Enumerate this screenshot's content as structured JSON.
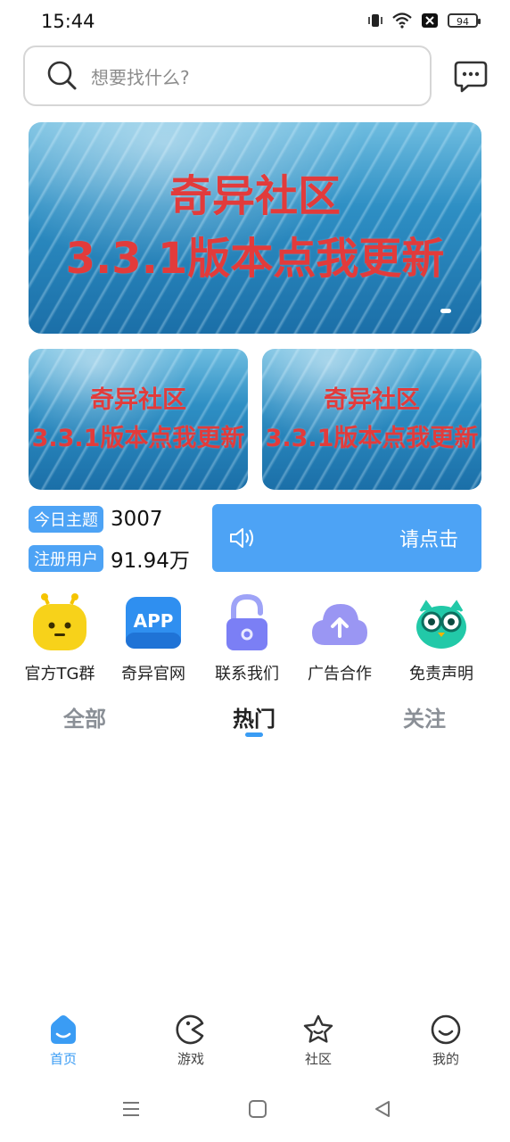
{
  "status_bar": {
    "time": "15:44",
    "battery": "94"
  },
  "search": {
    "placeholder": "想要找什么?"
  },
  "banners": {
    "main": {
      "line1": "奇异社区",
      "line2": "3.3.1版本点我更新"
    },
    "left": {
      "line1": "奇异社区",
      "line2": "3.3.1版本点我更新"
    },
    "right": {
      "line1": "奇异社区",
      "line2": "3.3.1版本点我更新"
    }
  },
  "stats": {
    "topics_label": "今日主题",
    "topics_value": "3007",
    "users_label": "注册用户",
    "users_value": "91.94万"
  },
  "notice": {
    "text": "请点击"
  },
  "quick_links": [
    {
      "label": "官方TG群",
      "icon": "robot-icon",
      "color": "#f5d020"
    },
    {
      "label": "奇异官网",
      "icon": "app-icon",
      "color": "#2f8ff0"
    },
    {
      "label": "联系我们",
      "icon": "unlock-icon",
      "color": "#7b7ff5"
    },
    {
      "label": "广告合作",
      "icon": "cloud-upload-icon",
      "color": "#8a86f0"
    },
    {
      "label": "免责声明",
      "icon": "owl-icon",
      "color": "#22c9a8"
    }
  ],
  "tabs": [
    {
      "label": "全部",
      "active": false
    },
    {
      "label": "热门",
      "active": true
    },
    {
      "label": "关注",
      "active": false
    }
  ],
  "bottom_nav": [
    {
      "label": "首页",
      "icon": "home-icon",
      "active": true
    },
    {
      "label": "游戏",
      "icon": "game-icon",
      "active": false
    },
    {
      "label": "社区",
      "icon": "star-icon",
      "active": false
    },
    {
      "label": "我的",
      "icon": "smile-icon",
      "active": false
    }
  ],
  "colors": {
    "accent": "#3a9cf4",
    "badge": "#4da3f5",
    "banner_text": "#e23b3b"
  }
}
